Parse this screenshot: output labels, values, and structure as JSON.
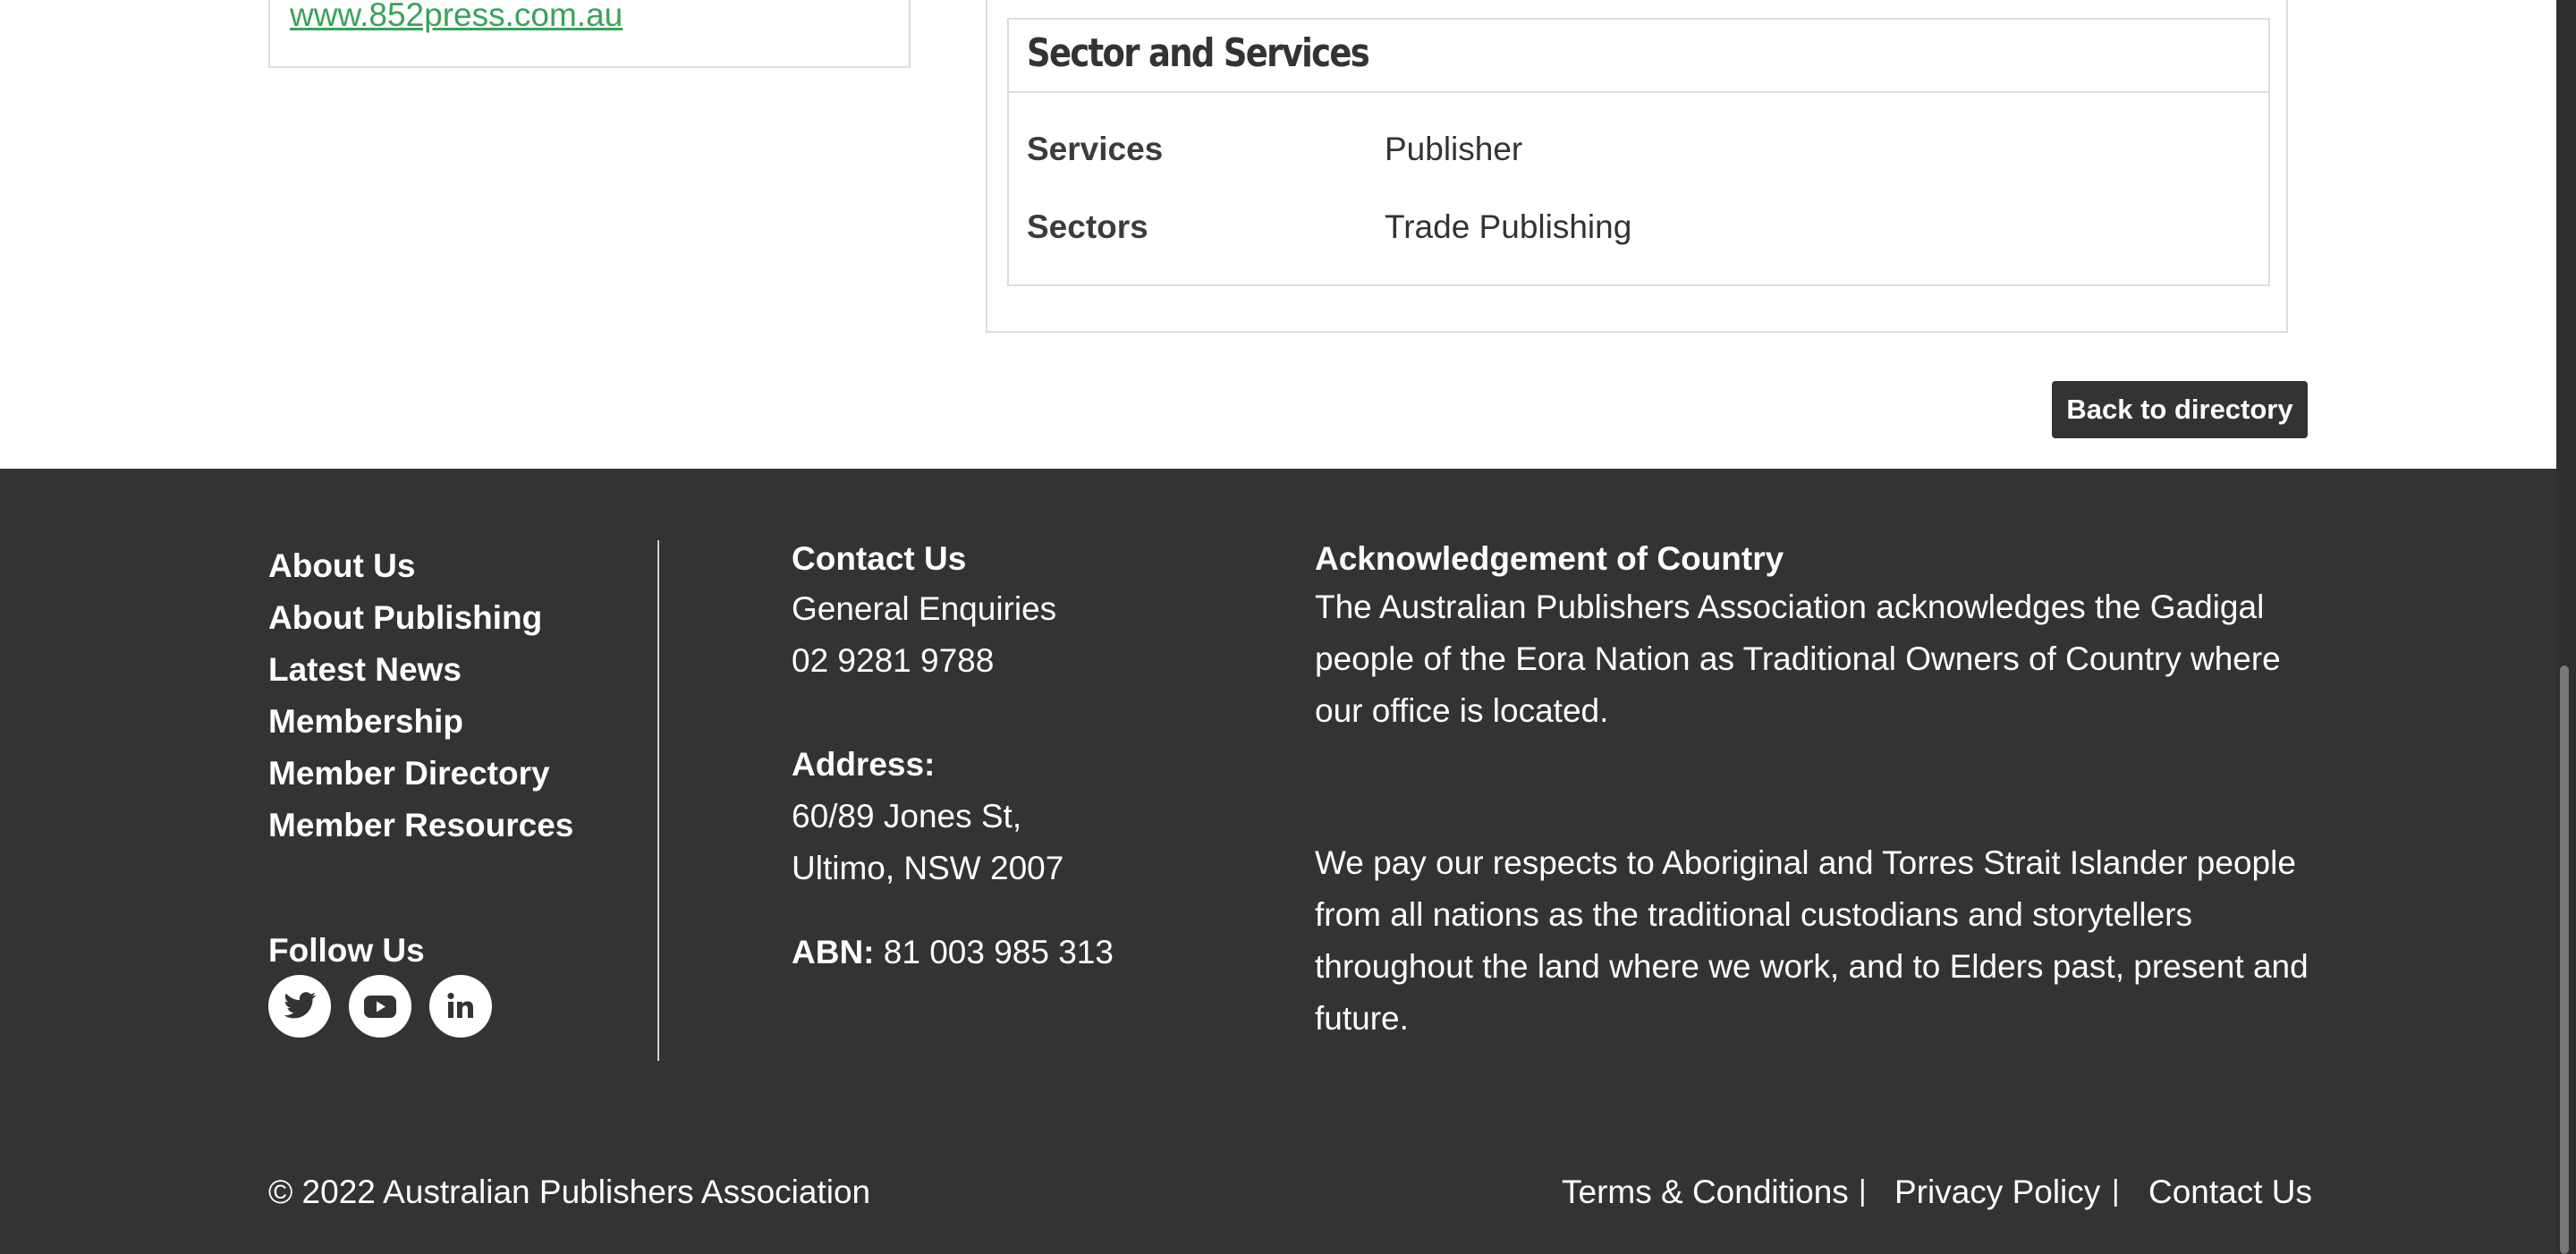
{
  "listing": {
    "website": "www.852press.com.au"
  },
  "sector_services": {
    "title": "Sector and Services",
    "rows": [
      {
        "label": "Services",
        "value": "Publisher"
      },
      {
        "label": "Sectors",
        "value": "Trade Publishing"
      }
    ]
  },
  "back_button": "Back to directory",
  "footer": {
    "nav": [
      "About Us",
      "About Publishing",
      "Latest News",
      "Membership",
      "Member Directory",
      "Member Resources"
    ],
    "follow_label": "Follow Us",
    "social": [
      {
        "name": "twitter-icon",
        "label": "Twitter"
      },
      {
        "name": "youtube-icon",
        "label": "YouTube"
      },
      {
        "name": "linkedin-icon",
        "label": "LinkedIn"
      }
    ],
    "contact": {
      "heading": "Contact Us",
      "enquiries_label": "General Enquiries",
      "phone": "02 9281 9788",
      "address_label": "Address:",
      "address_line1": "60/89 Jones St,",
      "address_line2": "Ultimo, NSW 2007",
      "abn_label": "ABN:",
      "abn_value": "81 003 985 313"
    },
    "acknowledgement": {
      "heading": "Acknowledgement of Country",
      "para1": "The Australian Publishers Association acknowledges the Gadigal people of the Eora Nation as Traditional Owners of Country where our office is located.",
      "para2": "We pay our respects to Aboriginal and Torres Strait Islander people from all nations as the traditional custodians and storytellers throughout the land where we work, and to Elders past, present and future."
    },
    "copyright": "© 2022 Australian Publishers Association",
    "legal_links": [
      "Terms & Conditions",
      "Privacy Policy",
      "Contact Us"
    ],
    "separator": "|"
  },
  "colors": {
    "link_green": "#3aa35a",
    "footer_bg": "#333333",
    "button_bg": "#333333",
    "border": "#dddddd"
  }
}
